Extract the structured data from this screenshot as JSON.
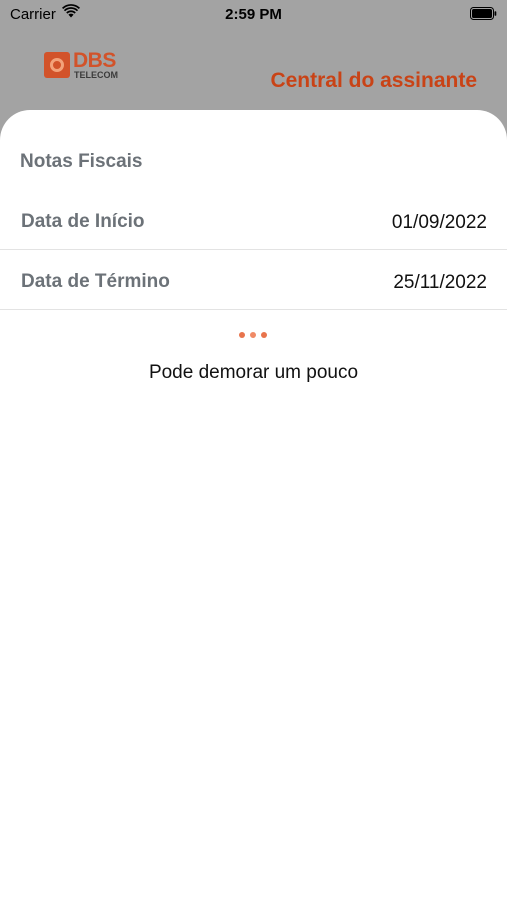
{
  "status_bar": {
    "carrier": "Carrier",
    "time": "2:59 PM",
    "wifi_icon": "wifi-icon",
    "battery_icon": "battery-icon"
  },
  "header": {
    "logo_text": "DBS",
    "logo_subtext": "TELECOM",
    "title": "Central do assinante"
  },
  "colors": {
    "accent": "#c94316",
    "label_gray": "#6c7278",
    "dot_colors": [
      "#e8744c",
      "#f08a66",
      "#e8744c"
    ]
  },
  "sheet": {
    "section_title": "Notas Fiscais",
    "start": {
      "label": "Data de Início",
      "value": "01/09/2022"
    },
    "end": {
      "label": "Data de Término",
      "value": "25/11/2022"
    },
    "loading_text": "Pode demorar um pouco"
  }
}
